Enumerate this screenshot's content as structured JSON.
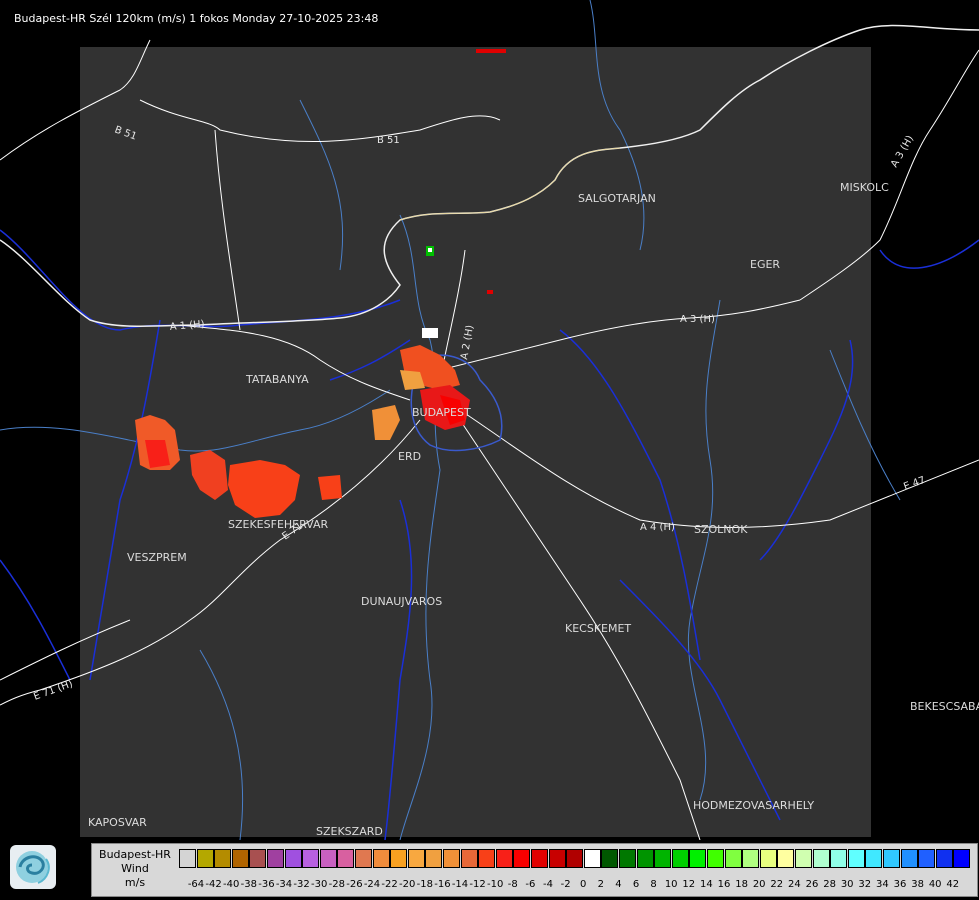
{
  "header": {
    "title": "Budapest-HR Szél 120km (m/s) 1 fokos Monday 27-10-2025 23:48"
  },
  "map": {
    "cities": [
      "TATABANYA",
      "BUDAPEST",
      "ERD",
      "SZEKESFEHERVAR",
      "VESZPREM",
      "DUNAUJVAROS",
      "KECSKEMET",
      "SZOLNOK",
      "SALGOTARJAN",
      "EGER",
      "MISKOLC",
      "BEKESCSABA",
      "HODMEZOVASARHELY",
      "KAPOSVAR",
      "SZEKSZARD"
    ],
    "roads": [
      "B 51",
      "B 51",
      "A 3 (H)",
      "A 3 (H)",
      "A 4 (H)",
      "E 71",
      "E 71 (H)",
      "A 2 (H)",
      "E 47",
      "A 1 (H)"
    ]
  },
  "legend": {
    "line1": "Budapest-HR",
    "line2": "Wind",
    "line3": "m/s",
    "colors": [
      "#d4d4d4",
      "#b4a800",
      "#b48c00",
      "#b06400",
      "#a85050",
      "#a040a0",
      "#a050e0",
      "#b860e0",
      "#c860c0",
      "#d860a0",
      "#e07850",
      "#f08c3c",
      "#f8a020",
      "#f8a840",
      "#f0a040",
      "#f09038",
      "#e86838",
      "#f84018",
      "#f82018",
      "#f80000",
      "#e00000",
      "#c80000",
      "#b00000",
      "#ffffff",
      "#005800",
      "#007800",
      "#009400",
      "#00b400",
      "#00d000",
      "#00f000",
      "#40ff00",
      "#80ff40",
      "#b0ff80",
      "#e8ff80",
      "#ffffa0",
      "#d0ffb0",
      "#b0ffd0",
      "#90ffe8",
      "#60ffff",
      "#40e8ff",
      "#30c8ff",
      "#2090ff",
      "#2060ff",
      "#1030f0",
      "#0000ff"
    ],
    "ticks": [
      "-64",
      "-42",
      "-40",
      "-38",
      "-36",
      "-34",
      "-32",
      "-30",
      "-28",
      "-26",
      "-24",
      "-22",
      "-20",
      "-18",
      "-16",
      "-14",
      "-12",
      "-10",
      "-8",
      "-6",
      "-4",
      "-2",
      "0",
      "2",
      "4",
      "6",
      "8",
      "10",
      "12",
      "14",
      "16",
      "18",
      "20",
      "22",
      "24",
      "26",
      "28",
      "30",
      "32",
      "34",
      "36",
      "38",
      "40",
      "42"
    ]
  }
}
